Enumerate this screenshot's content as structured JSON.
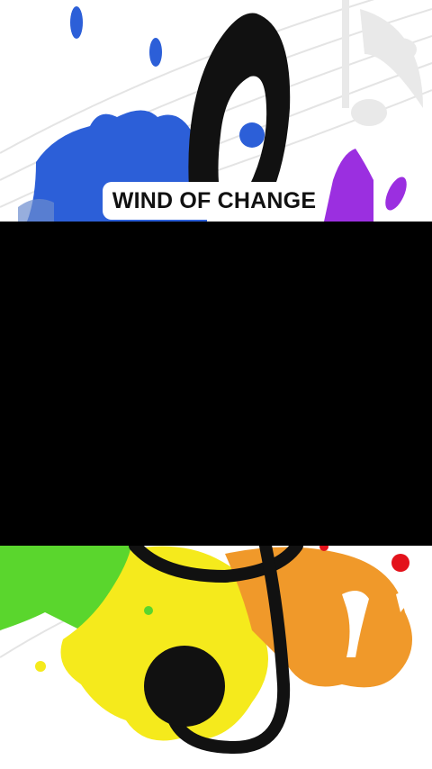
{
  "song_title": "WIND OF CHANGE",
  "colors": {
    "video_panel": "#000000",
    "splash_blue": "#2c5fd8",
    "splash_purple": "#9b2fe0",
    "splash_green": "#5ad62d",
    "splash_yellow": "#f5ea1c",
    "splash_orange": "#f0992a",
    "splash_red": "#e3121b",
    "clef": "#111111"
  }
}
